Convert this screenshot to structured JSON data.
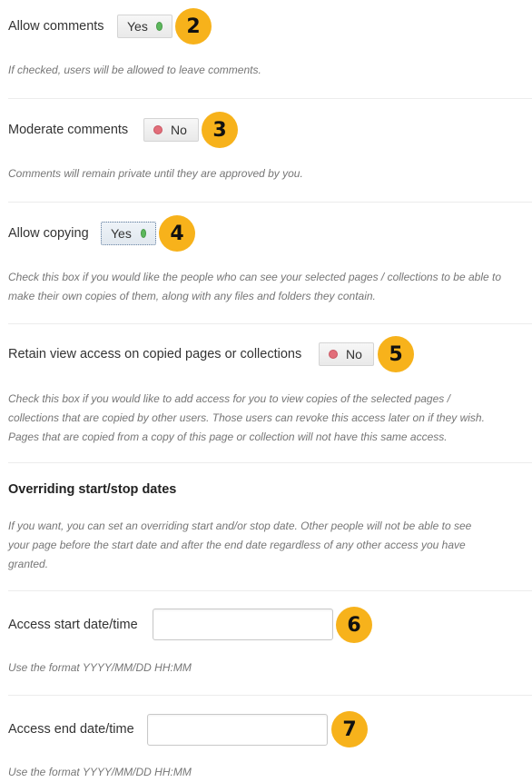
{
  "allow_comments": {
    "label": "Allow comments",
    "toggle_text": "Yes",
    "state": "on",
    "badge": "2",
    "description": "If checked, users will be allowed to leave comments."
  },
  "moderate_comments": {
    "label": "Moderate comments",
    "toggle_text": "No",
    "state": "off",
    "badge": "3",
    "description": "Comments will remain private until they are approved by you."
  },
  "allow_copying": {
    "label": "Allow copying",
    "toggle_text": "Yes",
    "state": "on",
    "badge": "4",
    "description_line1": "Check this box if you would like the people who can see your selected pages / collections to be able to",
    "description_line2": "make their own copies of them, along with any files and folders they contain."
  },
  "retain_view_access": {
    "label": "Retain view access on copied pages or collections",
    "toggle_text": "No",
    "state": "off",
    "badge": "5",
    "description_line1": "Check this box if you would like to add access for you to view copies of the selected pages /",
    "description_line2": "collections that are copied by other users. Those users can revoke this access later on if they wish.",
    "description_line3": "Pages that are copied from a copy of this page or collection will not have this same access."
  },
  "overriding_dates": {
    "heading": "Overriding start/stop dates",
    "description_line1": "If you want, you can set an overriding start and/or stop date. Other people will not be able to see",
    "description_line2": "your page before the start date and after the end date regardless of any other access you have",
    "description_line3": "granted."
  },
  "access_start": {
    "label": "Access start date/time",
    "value": "",
    "badge": "6",
    "hint": "Use the format YYYY/MM/DD HH:MM"
  },
  "access_end": {
    "label": "Access end date/time",
    "value": "",
    "badge": "7",
    "hint": "Use the format YYYY/MM/DD HH:MM"
  },
  "colors": {
    "badge": "#f7b21b",
    "on_dot": "#5cb85c",
    "off_dot": "#e26e7a"
  }
}
